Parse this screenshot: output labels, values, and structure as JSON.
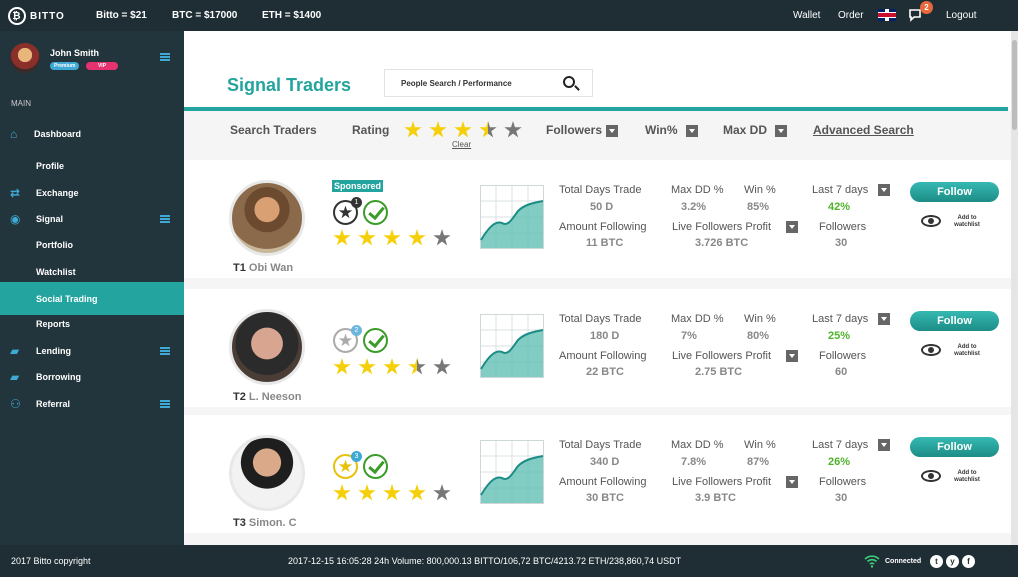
{
  "topbar": {
    "logo": "BITTO",
    "btc_ticker": "Bitto = $21",
    "btc_price": "BTC = $17000",
    "eth_price": "ETH = $1400",
    "wallet": "Wallet",
    "order": "Order",
    "chat_badge": "2",
    "logout": "Logout",
    "bg": "#1f2e35"
  },
  "user": {
    "name": "John Smith",
    "badges": [
      "Premium",
      "VIP"
    ]
  },
  "sidebar": {
    "section": "MAIN",
    "items": [
      {
        "label": "Dashboard",
        "icon": "home-icon"
      },
      {
        "label": "Profile"
      },
      {
        "label": "Exchange",
        "icon": "exchange-icon"
      },
      {
        "label": "Signal",
        "icon": "signal-icon"
      },
      {
        "label": "Portfolio"
      },
      {
        "label": "Watchlist"
      },
      {
        "label": "Social Trading",
        "active": true
      },
      {
        "label": "Reports"
      },
      {
        "label": "Lending",
        "icon": "lending-icon"
      },
      {
        "label": "Borrowing",
        "icon": "borrowing-icon"
      },
      {
        "label": "Referral",
        "icon": "referral-icon"
      }
    ]
  },
  "page": {
    "title": "Signal Traders",
    "search_placeholder": "People Search / Performance",
    "accent": "#24a49e"
  },
  "filters": {
    "search_traders": "Search Traders",
    "rating": "Rating",
    "rating_value": 3.5,
    "clear": "Clear",
    "followers": "Followers",
    "win": "Win%",
    "maxdd": "Max DD",
    "advanced": "Advanced Search"
  },
  "labels": {
    "total_days": "Total Days Trade",
    "maxdd": "Max DD %",
    "win": "Win %",
    "last7": "Last 7 days",
    "amount_following": "Amount Following",
    "live_profit": "Live Followers Profit",
    "followers": "Followers",
    "follow": "Follow",
    "watchlist_line1": "Add to",
    "watchlist_line2": "watchlist",
    "sponsored": "Sponsored"
  },
  "traders": [
    {
      "rank": "T1",
      "name": "Obi Wan",
      "rank_num": "1",
      "rating": 4,
      "total_days": "50 D",
      "maxdd": "3.2%",
      "win": "85%",
      "last7": "42%",
      "amount": "11 BTC",
      "profit": "3.726 BTC",
      "followers": "30",
      "sponsored": true
    },
    {
      "rank": "T2",
      "name": "L. Neeson",
      "rank_num": "2",
      "rating": 3.5,
      "total_days": "180 D",
      "maxdd": "7%",
      "win": "80%",
      "last7": "25%",
      "amount": "22 BTC",
      "profit": "2.75 BTC",
      "followers": "60",
      "sponsored": false
    },
    {
      "rank": "T3",
      "name": "Simon. C",
      "rank_num": "3",
      "rating": 4,
      "total_days": "340 D",
      "maxdd": "7.8%",
      "win": "87%",
      "last7": "26%",
      "amount": "30 BTC",
      "profit": "3.9 BTC",
      "followers": "30",
      "sponsored": false
    }
  ],
  "footer": {
    "copyright": "2017 Bitto copyright",
    "ticker": "2017-12-15 16:05:28 24h Volume: 800,000.13 BITTO/106,72 BTC/4213.72 ETH/238,860,74 USDT",
    "connected": "Connected",
    "social": [
      "t",
      "y",
      "f"
    ]
  }
}
